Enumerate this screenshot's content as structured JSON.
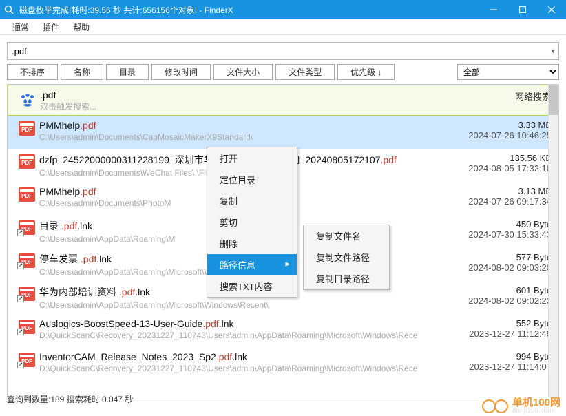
{
  "titlebar": {
    "title": "磁盘枚举完成!耗时:39.56 秒 共计:656156个对象!    -  FinderX"
  },
  "menu": {
    "items": [
      "通常",
      "插件",
      "帮助"
    ]
  },
  "search": {
    "value": ".pdf"
  },
  "toolbar": {
    "buttons": [
      "不排序",
      "名称",
      "目录",
      "修改时间",
      "文件大小",
      "文件类型",
      "优先级 ↓"
    ],
    "filter": "全部"
  },
  "hint": {
    "query": ".pdf",
    "sub": "双击触发搜索...",
    "net": "网络搜索"
  },
  "rows": [
    {
      "name_pre": "PMMhelp",
      "name_hl": ".pdf",
      "name_post": "",
      "path": "C:\\Users\\admin\\Documents\\CapMosaicMakerX9Standard\\",
      "size": "3.33 MB",
      "date": "2024-07-26 10:46:25",
      "lnk": false,
      "selected": true
    },
    {
      "name_pre": "dzfp_24522000000311228199_深圳市华洋志远科技有限公司_20240805172107",
      "name_hl": ".pdf",
      "name_post": "",
      "path": "C:\\Users\\admin\\Documents\\WeChat Files\\                         \\FileStorage\\File\\2024-08\\",
      "size": "135.56 KB",
      "date": "2024-08-05 17:32:18",
      "lnk": false
    },
    {
      "name_pre": "PMMhelp",
      "name_hl": ".pdf",
      "name_post": "",
      "path": "C:\\Users\\admin\\Documents\\PhotoM",
      "size": "3.13 MB",
      "date": "2024-07-26 09:17:34",
      "lnk": false
    },
    {
      "name_pre": "目录 ",
      "name_hl": ".pdf",
      "name_post": ".lnk",
      "path": "C:\\Users\\admin\\AppData\\Roaming\\M",
      "size": "450 Byte",
      "date": "2024-07-30 15:33:43",
      "lnk": true
    },
    {
      "name_pre": "停车发票 ",
      "name_hl": ".pdf",
      "name_post": ".lnk",
      "path": "C:\\Users\\admin\\AppData\\Roaming\\Microsoft\\Windows\\Recent\\",
      "size": "577 Byte",
      "date": "2024-08-02 09:03:20",
      "lnk": true
    },
    {
      "name_pre": "华为内部培训资料 ",
      "name_hl": ".pdf",
      "name_post": ".lnk",
      "path": "C:\\Users\\admin\\AppData\\Roaming\\Microsoft\\Windows\\Recent\\",
      "size": "601 Byte",
      "date": "2024-08-02 09:02:23",
      "lnk": true
    },
    {
      "name_pre": "Auslogics-BoostSpeed-13-User-Guide",
      "name_hl": ".pdf",
      "name_post": ".lnk",
      "path": "D:\\QuickScanC\\Recovery_20231227_110743\\Users\\admin\\AppData\\Roaming\\Microsoft\\Windows\\Rece",
      "size": "552 Byte",
      "date": "2023-12-27 11:12:49",
      "lnk": true
    },
    {
      "name_pre": "InventorCAM_Release_Notes_2023_Sp2",
      "name_hl": ".pdf",
      "name_post": ".lnk",
      "path": "D:\\QuickScanC\\Recovery_20231227_110743\\Users\\admin\\AppData\\Roaming\\Microsoft\\Windows\\Rece",
      "size": "994 Byte",
      "date": "2023-12-27 11:14:07",
      "lnk": true
    }
  ],
  "context": {
    "main": [
      "打开",
      "定位目录",
      "复制",
      "剪切",
      "删除",
      "路径信息",
      "搜索TXT内容"
    ],
    "sub": [
      "复制文件名",
      "复制文件路径",
      "复制目录路径"
    ]
  },
  "status": "查询到数量:189   搜索耗时:0.047 秒",
  "watermark": {
    "brand": "单机100网",
    "url": "danji100.com"
  }
}
